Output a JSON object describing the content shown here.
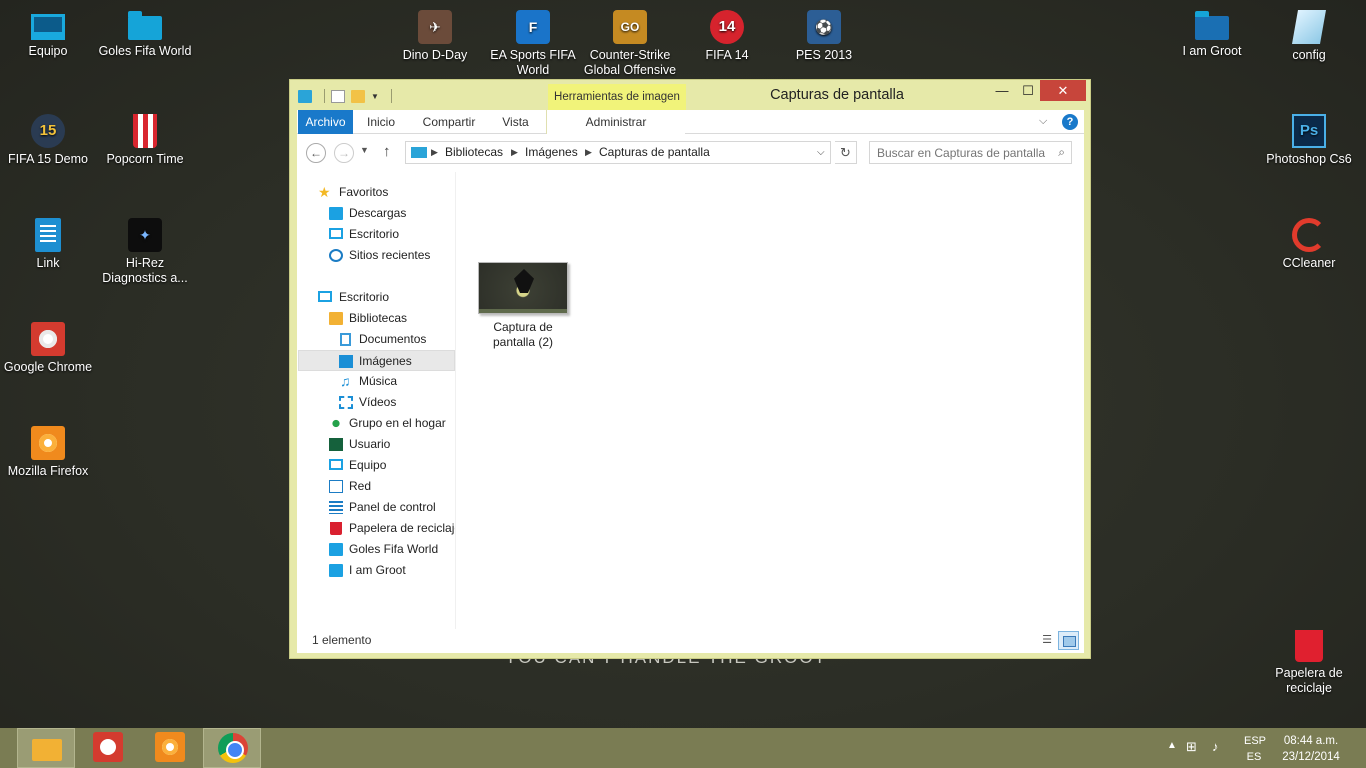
{
  "desktop": {
    "icons": [
      {
        "label": "Equipo",
        "icon": "computer-icon"
      },
      {
        "label": "Goles Fifa World",
        "icon": "folder-icon"
      },
      {
        "label": "Dino D-Day",
        "icon": "dino-dday-icon"
      },
      {
        "label": "EA Sports FIFA World",
        "icon": "fifa-world-icon"
      },
      {
        "label": "Counter-Strike Global Offensive",
        "icon": "csgo-icon"
      },
      {
        "label": "FIFA 14",
        "icon": "fifa14-icon"
      },
      {
        "label": "PES 2013",
        "icon": "pes2013-icon"
      },
      {
        "label": "I am Groot",
        "icon": "folder-icon"
      },
      {
        "label": "config",
        "icon": "config-file-icon"
      },
      {
        "label": "FIFA 15 Demo",
        "icon": "fifa15-icon"
      },
      {
        "label": "Popcorn Time",
        "icon": "popcorn-icon"
      },
      {
        "label": "Photoshop Cs6",
        "icon": "photoshop-icon"
      },
      {
        "label": "Link",
        "icon": "document-icon"
      },
      {
        "label": "Hi-Rez Diagnostics a...",
        "icon": "hirez-icon"
      },
      {
        "label": "CCleaner",
        "icon": "ccleaner-icon"
      },
      {
        "label": "Google Chrome",
        "icon": "chrome-icon"
      },
      {
        "label": "Mozilla Firefox",
        "icon": "firefox-icon"
      },
      {
        "label": "Papelera de reciclaje",
        "icon": "recycle-bin-icon"
      }
    ],
    "wallpaper_text": "YOU CAN'T HANDLE THE GROOT"
  },
  "window": {
    "title": "Capturas de pantalla",
    "contextual_tab": "Herramientas de imagen",
    "controls": {
      "minimize": "—",
      "maximize": "☐",
      "close": "✕"
    },
    "ribbon_tabs": [
      "Archivo",
      "Inicio",
      "Compartir",
      "Vista",
      "Administrar"
    ],
    "address": {
      "breadcrumbs": [
        "Bibliotecas",
        "Imágenes",
        "Capturas de pantalla"
      ]
    },
    "search_placeholder": "Buscar en Capturas de pantalla",
    "nav_pane": [
      {
        "label": "Favoritos",
        "icon": "star-icon"
      },
      {
        "label": "Descargas",
        "icon": "downloads-icon"
      },
      {
        "label": "Escritorio",
        "icon": "desktop-icon"
      },
      {
        "label": "Sitios recientes",
        "icon": "recent-places-icon"
      },
      {
        "label": "Escritorio",
        "icon": "desktop-icon"
      },
      {
        "label": "Bibliotecas",
        "icon": "libraries-icon"
      },
      {
        "label": "Documentos",
        "icon": "documents-icon"
      },
      {
        "label": "Imágenes",
        "icon": "pictures-icon",
        "selected": true
      },
      {
        "label": "Música",
        "icon": "music-icon"
      },
      {
        "label": "Vídeos",
        "icon": "videos-icon"
      },
      {
        "label": "Grupo en el hogar",
        "icon": "homegroup-icon"
      },
      {
        "label": "Usuario",
        "icon": "user-icon"
      },
      {
        "label": "Equipo",
        "icon": "computer-icon"
      },
      {
        "label": "Red",
        "icon": "network-icon"
      },
      {
        "label": "Panel de control",
        "icon": "control-panel-icon"
      },
      {
        "label": "Papelera de reciclaje",
        "icon": "recycle-bin-icon"
      },
      {
        "label": "Goles Fifa World",
        "icon": "folder-icon"
      },
      {
        "label": "I am Groot",
        "icon": "folder-icon"
      }
    ],
    "files": [
      {
        "name": "Captura de pantalla (2)",
        "icon": "image-thumbnail"
      }
    ],
    "status": "1 elemento",
    "colors": {
      "frame": "#e6e9a9",
      "accent": "#1979ca",
      "close": "#c7453b",
      "contextual_tab": "#f1f37a"
    }
  },
  "taskbar": {
    "apps": [
      {
        "name": "Explorador de archivos",
        "icon": "file-explorer-icon",
        "active": true
      },
      {
        "name": "Google Chrome",
        "icon": "chrome-icon"
      },
      {
        "name": "Mozilla Firefox",
        "icon": "firefox-icon"
      },
      {
        "name": "Google Chrome",
        "icon": "chrome-icon"
      }
    ],
    "lang_top": "ESP",
    "lang_bottom": "ES",
    "time": "08:44 a.m.",
    "date": "23/12/2014",
    "color": "#7a7c53"
  }
}
